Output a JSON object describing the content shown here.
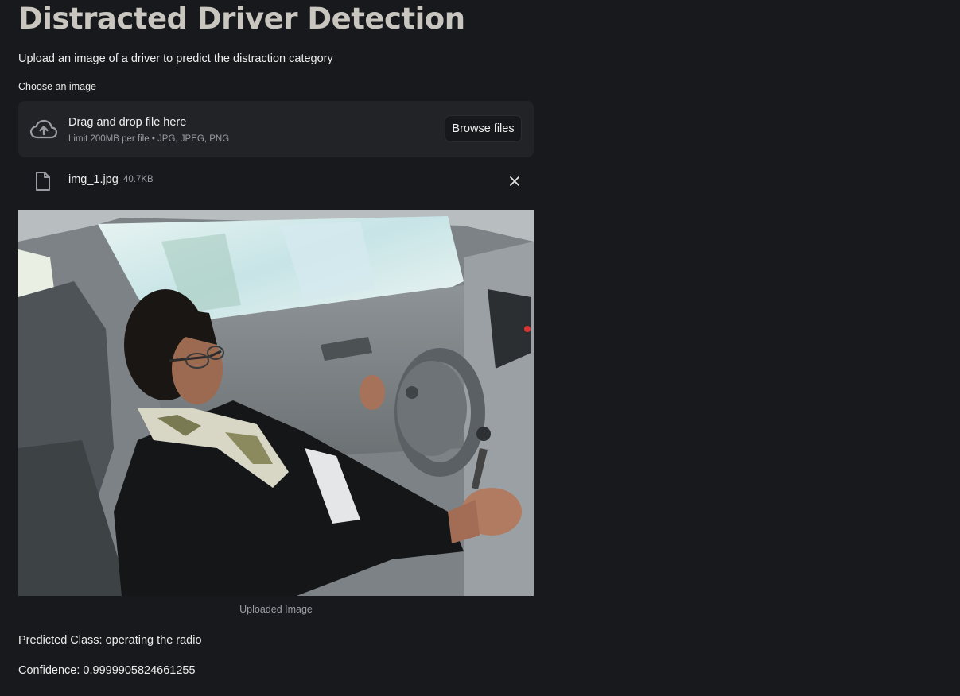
{
  "page": {
    "title": "Distracted Driver Detection",
    "subtitle": "Upload an image of a driver to predict the distraction category"
  },
  "uploader": {
    "label": "Choose an image",
    "drop_title": "Drag and drop file here",
    "limit_text": "Limit 200MB per file • JPG, JPEG, PNG",
    "browse_label": "Browse files",
    "icon": "cloud-upload-icon"
  },
  "file": {
    "name": "img_1.jpg",
    "size": "40.7KB",
    "icon": "file-icon",
    "remove_icon": "close-icon"
  },
  "image": {
    "caption": "Uploaded Image"
  },
  "result": {
    "class_label": "Predicted Class:",
    "class_value": "operating the radio",
    "confidence_label": "Confidence:",
    "confidence_value": "0.9999905824661255"
  },
  "colors": {
    "background": "#18191c",
    "dropzone": "#222327",
    "title": "#c9c5bf",
    "muted_text": "#9a9ca3"
  }
}
